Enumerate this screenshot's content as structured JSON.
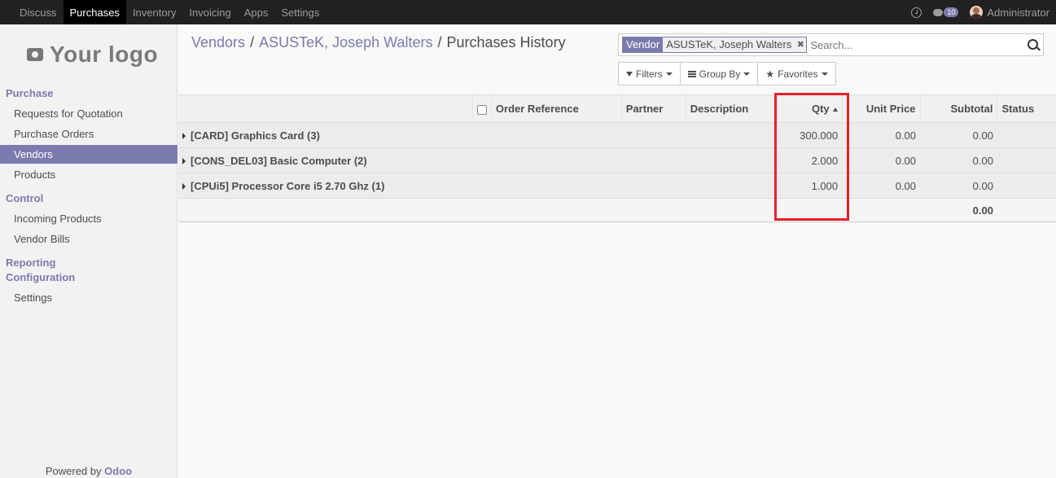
{
  "topbar": {
    "menu": [
      "Discuss",
      "Purchases",
      "Inventory",
      "Invoicing",
      "Apps",
      "Settings"
    ],
    "active_index": 1,
    "message_count": "10",
    "user_name": "Administrator"
  },
  "sidebar": {
    "logo_text": "Your logo",
    "sections": [
      {
        "title": "Purchase",
        "items": [
          "Requests for Quotation",
          "Purchase Orders",
          "Vendors",
          "Products"
        ]
      },
      {
        "title": "Control",
        "items": [
          "Incoming Products",
          "Vendor Bills"
        ]
      },
      {
        "title": "Reporting",
        "items": []
      },
      {
        "title": "Configuration",
        "items": [
          "Settings"
        ]
      }
    ],
    "active_item": "Vendors",
    "powered_prefix": "Powered by ",
    "powered_brand": "Odoo"
  },
  "breadcrumb": {
    "items": [
      "Vendors",
      "ASUSTeK, Joseph Walters"
    ],
    "current": "Purchases History"
  },
  "search": {
    "facet_category": "Vendor",
    "facet_value": "ASUSTeK, Joseph Walters",
    "placeholder": "Search..."
  },
  "buttons": {
    "filters": "Filters",
    "group_by": "Group By",
    "favorites": "Favorites"
  },
  "table": {
    "columns": [
      "Order Reference",
      "Partner",
      "Description",
      "Qty",
      "Unit Price",
      "Subtotal",
      "Status"
    ],
    "groups": [
      {
        "name": "[CARD] Graphics Card (3)",
        "qty": "300.000",
        "unit_price": "0.00",
        "subtotal": "0.00"
      },
      {
        "name": "[CONS_DEL03] Basic Computer (2)",
        "qty": "2.000",
        "unit_price": "0.00",
        "subtotal": "0.00"
      },
      {
        "name": "[CPUi5] Processor Core i5 2.70 Ghz (1)",
        "qty": "1.000",
        "unit_price": "0.00",
        "subtotal": "0.00"
      }
    ],
    "footer_subtotal": "0.00"
  },
  "colors": {
    "brand": "#7c7bad",
    "topbar": "#212121",
    "highlight": "#e8202a"
  }
}
